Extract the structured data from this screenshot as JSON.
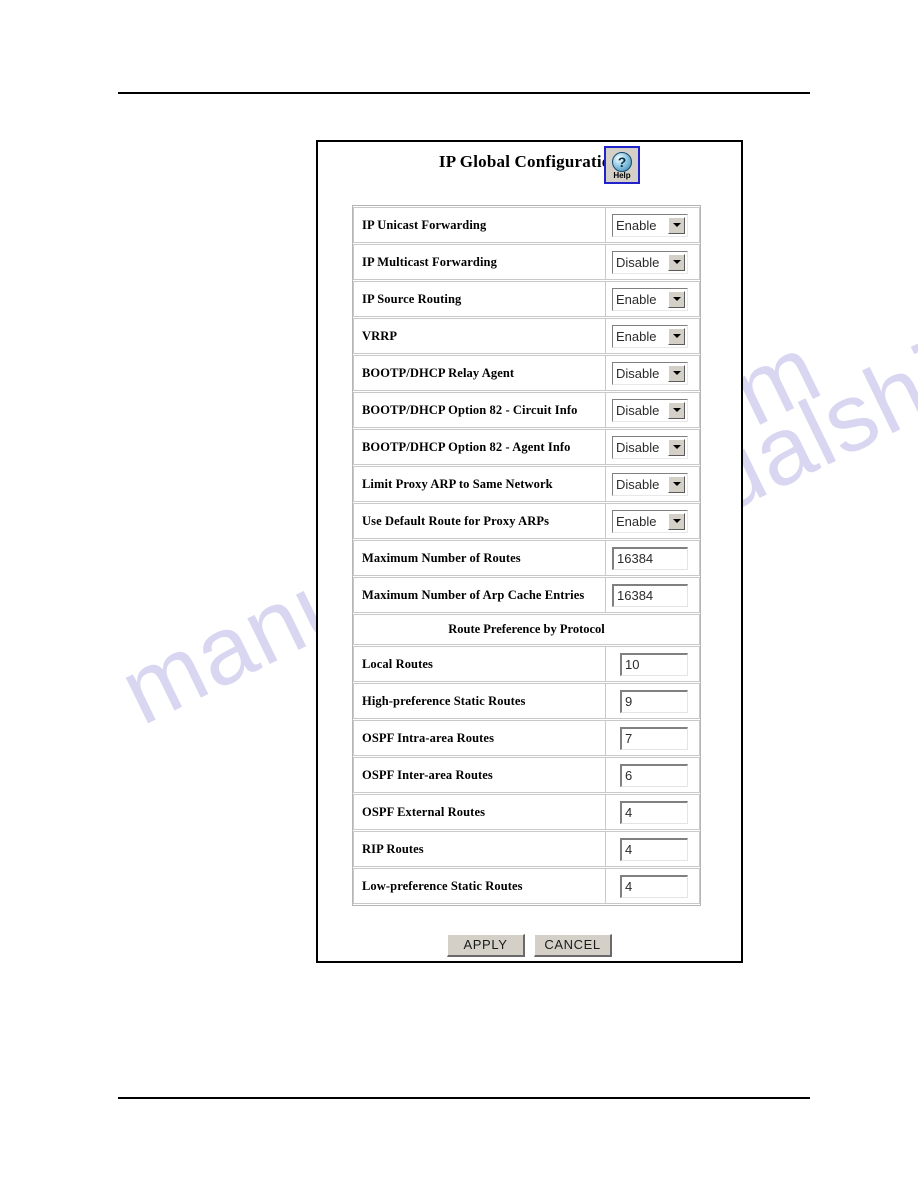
{
  "document": {
    "watermark_text": "manualshive.com"
  },
  "panel": {
    "title": "IP Global Configuration",
    "help_button": {
      "icon": "question-mark-icon",
      "label": "Help",
      "glyph": "?"
    }
  },
  "form": {
    "rows": [
      {
        "label": "IP Unicast Forwarding",
        "control": "select",
        "value": "Enable"
      },
      {
        "label": "IP Multicast Forwarding",
        "control": "select",
        "value": "Disable"
      },
      {
        "label": "IP Source Routing",
        "control": "select",
        "value": "Enable"
      },
      {
        "label": "VRRP",
        "control": "select",
        "value": "Enable"
      },
      {
        "label": "BOOTP/DHCP Relay Agent",
        "control": "select",
        "value": "Disable"
      },
      {
        "label": "BOOTP/DHCP Option 82 - Circuit Info",
        "control": "select",
        "value": "Disable"
      },
      {
        "label": "BOOTP/DHCP Option 82 - Agent Info",
        "control": "select",
        "value": "Disable"
      },
      {
        "label": "Limit Proxy ARP to Same Network",
        "control": "select",
        "value": "Disable"
      },
      {
        "label": "Use Default Route for Proxy ARPs",
        "control": "select",
        "value": "Enable"
      },
      {
        "label": "Maximum Number of Routes",
        "control": "text",
        "value": "16384"
      },
      {
        "label": "Maximum Number of Arp Cache Entries",
        "control": "text",
        "value": "16384"
      },
      {
        "label": "Route Preference by Protocol",
        "control": "section"
      },
      {
        "label": "Local Routes",
        "control": "text-slim",
        "value": "10"
      },
      {
        "label": "High-preference Static Routes",
        "control": "text-slim",
        "value": "9"
      },
      {
        "label": "OSPF Intra-area Routes",
        "control": "text-slim",
        "value": "7"
      },
      {
        "label": "OSPF Inter-area Routes",
        "control": "text-slim",
        "value": "6"
      },
      {
        "label": "OSPF External Routes",
        "control": "text-slim",
        "value": "4"
      },
      {
        "label": "RIP Routes",
        "control": "text-slim",
        "value": "4"
      },
      {
        "label": "Low-preference Static Routes",
        "control": "text-slim",
        "value": "4"
      }
    ],
    "select_options": [
      "Enable",
      "Disable"
    ]
  },
  "buttons": {
    "apply": "APPLY",
    "cancel": "CANCEL"
  }
}
